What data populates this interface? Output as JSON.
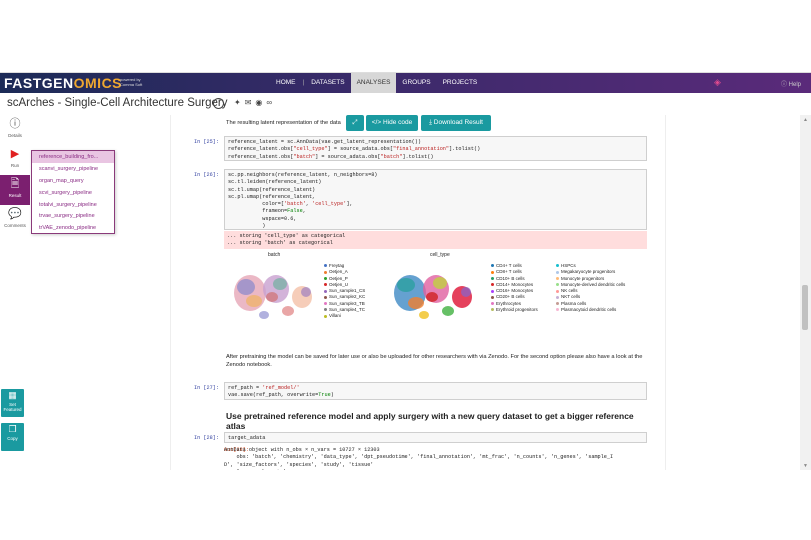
{
  "brand": {
    "name_part1": "FASTGEN",
    "name_part2": "OMICS",
    "sub": "powered by Comma Soft"
  },
  "nav": {
    "items": [
      "HOME",
      "DATASETS",
      "ANALYSES",
      "GROUPS",
      "PROJECTS"
    ],
    "active": "ANALYSES",
    "help": "Help"
  },
  "page": {
    "title": "scArches - Single-Cell Architecture Surgery",
    "share_icons": [
      "twitter-icon",
      "email-icon",
      "pocket-icon",
      "link-icon"
    ]
  },
  "sidebar": {
    "details": "Details",
    "run": "Run",
    "result": "Result",
    "comments": "Comments"
  },
  "dropdown": {
    "items": [
      "reference_building_fro...",
      "scanvi_surgery_pipeline",
      "organ_map_query",
      "scvi_surgery_pipeline",
      "totalvi_surgery_pipeline",
      "trvae_surgery_pipeline",
      "trVAE_zenodo_pipeline"
    ]
  },
  "left_buttons": {
    "featured": "Set Featured",
    "copy": "Copy"
  },
  "toolbar": {
    "hide_code": "Hide code",
    "download": "Download Result"
  },
  "notebook": {
    "intro_text": "The resulting latent representation of the data",
    "cell25": {
      "prompt": "In [25]:"
    },
    "cell26": {
      "prompt": "In [26]:"
    },
    "stderr": "... storing 'cell_type' as categorical\n... storing 'batch' as categorical",
    "plot_left_title": "batch",
    "plot_right_title": "cell_type",
    "batch_legend": [
      "Freytag",
      "Oetjen_A",
      "Oetjen_P",
      "Oetjen_U",
      "Sun_sample1_CS",
      "Sun_sample2_KC",
      "Sun_sample3_TB",
      "Sun_sample4_TC",
      "Villani"
    ],
    "celltype_legend_col1": [
      "CD4+ T cells",
      "CD8+ T cells",
      "CD10+ B cells",
      "CD14+ Monocytes",
      "CD16+ Monocytes",
      "CD20+ B cells",
      "Erythrocytes",
      "Erythroid progenitors"
    ],
    "celltype_legend_col2": [
      "HSPCs",
      "Megakaryocyte progenitors",
      "Monocyte progenitors",
      "Monocyte-derived dendritic cells",
      "NK cells",
      "NKT cells",
      "Plasma cells",
      "Plasmacytoid dendritic cells"
    ],
    "para": "After pretraining the model can be saved for later use or also be uploaded for other researchers with via Zenodo. For the second option please also have a look at the Zenodo notebook.",
    "cell27": {
      "prompt": "In [27]:"
    },
    "heading": "Use pretrained reference model and apply surgery with a new query dataset to get a bigger reference atlas",
    "cell28": {
      "prompt": "In [28]:",
      "code": "target_adata"
    },
    "out28": {
      "prompt": "Out[28]:",
      "text": "AnnData object with n_obs × n_vars = 10727 × 12303\n    obs: 'batch', 'chemistry', 'data_type', 'dpt_pseudotime', 'final_annotation', 'mt_frac', 'n_counts', 'n_genes', 'sample_I\nD', 'size_factors', 'species', 'study', 'tissue'\n    layers: 'counts'"
    }
  },
  "colors": {
    "result_bg": "#7b1f6f",
    "teal": "#1a9aa0",
    "nav_dark": "#1c2b57"
  }
}
